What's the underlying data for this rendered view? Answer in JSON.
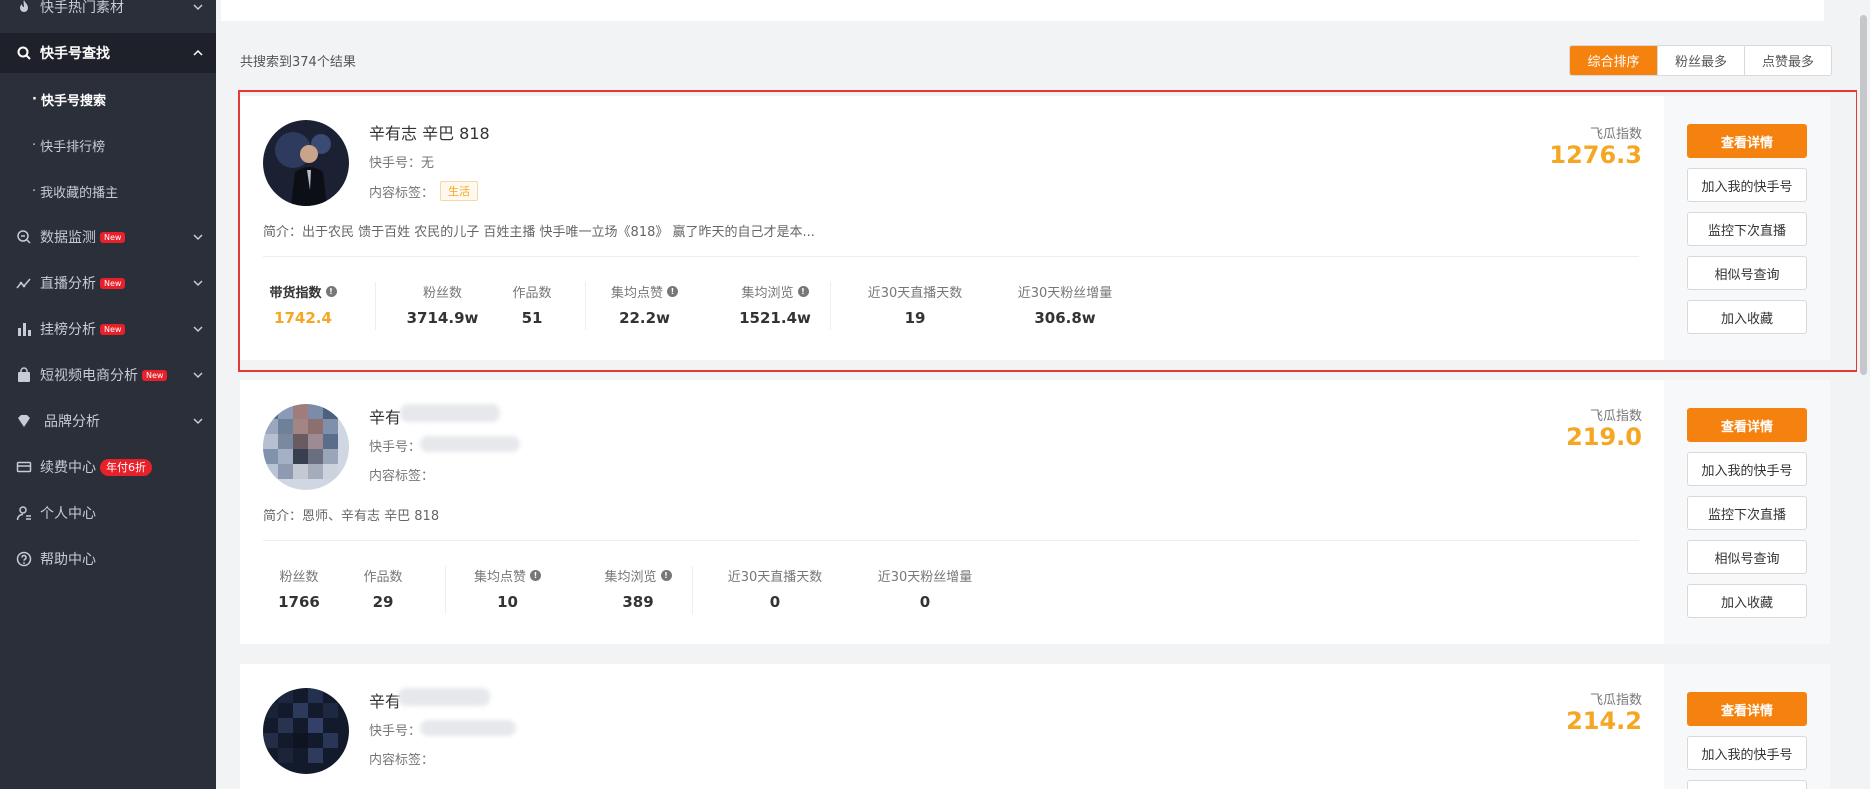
{
  "sidebar": {
    "items": [
      {
        "label": "快手热门素材"
      },
      {
        "label": "快手号查找"
      },
      {
        "label": "数据监测",
        "badge": "New"
      },
      {
        "label": "直播分析",
        "badge": "New"
      },
      {
        "label": "挂榜分析",
        "badge": "New"
      },
      {
        "label": "短视频电商分析",
        "badge": "New"
      },
      {
        "label": "品牌分析"
      },
      {
        "label": "续费中心",
        "badge": "年付6折"
      },
      {
        "label": "个人中心"
      },
      {
        "label": "帮助中心"
      }
    ],
    "sub_items": [
      {
        "label": "快手号搜索"
      },
      {
        "label": "快手排行榜"
      },
      {
        "label": "我收藏的播主"
      }
    ]
  },
  "results": {
    "count_text": "共搜索到374个结果"
  },
  "sort": {
    "options": [
      "综合排序",
      "粉丝最多",
      "点赞最多"
    ],
    "active": "综合排序"
  },
  "labels": {
    "score": "飞瓜指数",
    "acct_prefix": "快手号：",
    "tags_prefix": "内容标签：",
    "bio_prefix": "简介：",
    "sales_index": "带货指数",
    "fans": "粉丝数",
    "works": "作品数",
    "avg_likes": "集均点赞",
    "avg_views": "集均浏览",
    "live_days": "近30天直播天数",
    "fans_growth": "近30天粉丝增量"
  },
  "actions": [
    "查看详情",
    "加入我的快手号",
    "监控下次直播",
    "相似号查询",
    "加入收藏"
  ],
  "cards": [
    {
      "name": "辛有志 辛巴 818",
      "acct": "无",
      "tag": "生活",
      "bio": "出于农民 馈于百姓 农民的儿子 百姓主播 快手唯一立场《818》 赢了昨天的自己才是本...",
      "score": "1276.3",
      "metrics": {
        "sales_index": "1742.4",
        "fans": "3714.9w",
        "works": "51",
        "avg_likes": "22.2w",
        "avg_views": "1521.4w",
        "live_days": "19",
        "fans_growth": "306.8w"
      }
    },
    {
      "name": "辛有",
      "bio": "恩师、辛有志 辛巴 818",
      "score": "219.0",
      "metrics": {
        "fans": "1766",
        "works": "29",
        "avg_likes": "10",
        "avg_views": "389",
        "live_days": "0",
        "fans_growth": "0"
      }
    },
    {
      "name": "辛有",
      "score": "214.2"
    }
  ],
  "colors": {
    "accent": "#f5820f",
    "score": "#f5a623",
    "sidebar_bg": "#2b2f3a",
    "highlight": "#e53935",
    "badge": "#e8202a"
  },
  "icons": [
    "fire-icon",
    "search-icon",
    "monitor-icon",
    "trend-icon",
    "bar-chart-icon",
    "bag-icon",
    "diamond-icon",
    "card-icon",
    "user-icon",
    "help-icon",
    "info-icon",
    "chevron-icon"
  ]
}
